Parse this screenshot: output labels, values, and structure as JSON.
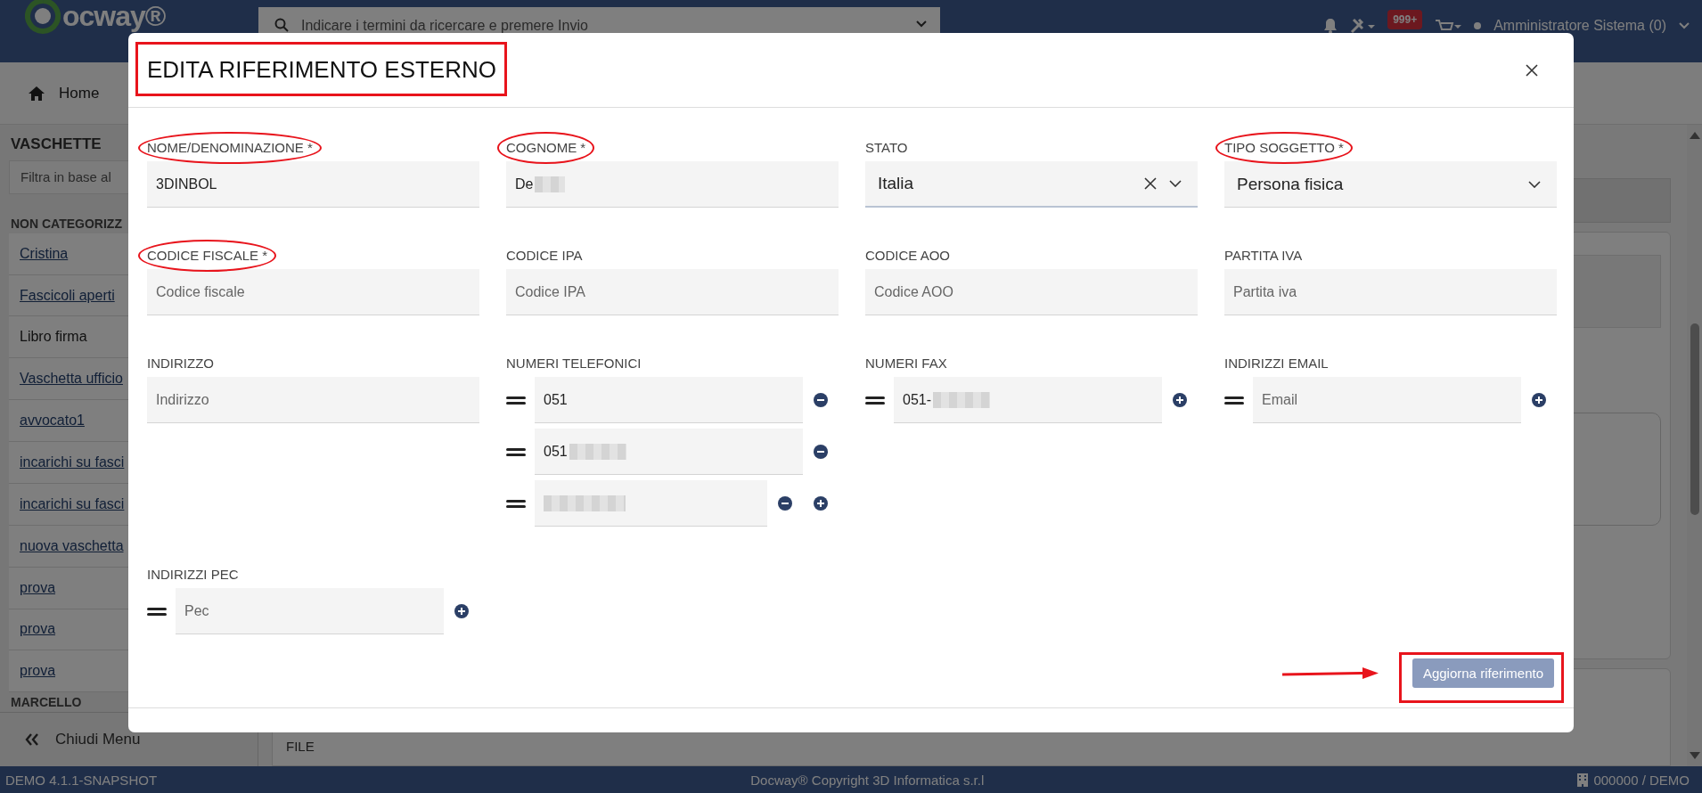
{
  "header": {
    "logo_text": "ocway®",
    "search_placeholder": "Indicare i termini da ricercare e premere Invio",
    "notification_badge": "999+",
    "user_name": "Amministratore Sistema (0)"
  },
  "breadcrumb": {
    "label": "Home"
  },
  "sidebar": {
    "title": "VASCHETTE",
    "filter_placeholder": "Filtra in base al",
    "groups": [
      {
        "title": "NON CATEGORIZZ",
        "items": [
          {
            "label": "Cristina",
            "link": true
          },
          {
            "label": "Fascicoli aperti",
            "link": true
          },
          {
            "label": "Libro firma",
            "link": false
          },
          {
            "label": "Vaschetta ufficio",
            "link": true
          },
          {
            "label": "avvocato1",
            "link": true
          },
          {
            "label": "incarichi su fasci",
            "link": true
          },
          {
            "label": "incarichi su fasci",
            "link": true
          },
          {
            "label": "nuova vaschetta",
            "link": true
          },
          {
            "label": "prova",
            "link": true
          },
          {
            "label": "prova",
            "link": true
          },
          {
            "label": "prova",
            "link": true
          }
        ]
      },
      {
        "title": "MARCELLO"
      }
    ],
    "close_menu": "Chiudi Menu"
  },
  "main": {
    "section_label": "FILE"
  },
  "modal": {
    "title": "EDITA RIFERIMENTO ESTERNO",
    "title_highlighted": true,
    "fields": [
      {
        "kind": "text",
        "label": "NOME/DENOMINAZIONE *",
        "highlighted": true,
        "value": "3DINBOL",
        "redacted": false
      },
      {
        "kind": "text",
        "label": "COGNOME *",
        "highlighted": true,
        "value": "De",
        "redacted": true
      },
      {
        "kind": "select",
        "label": "STATO",
        "highlighted": false,
        "value": "Italia",
        "clearable": true
      },
      {
        "kind": "select",
        "label": "TIPO SOGGETTO *",
        "highlighted": true,
        "value": "Persona fisica",
        "clearable": false
      },
      {
        "kind": "text",
        "label": "CODICE FISCALE *",
        "highlighted": true,
        "placeholder": "Codice fiscale"
      },
      {
        "kind": "text",
        "label": "CODICE IPA",
        "highlighted": false,
        "placeholder": "Codice IPA"
      },
      {
        "kind": "text",
        "label": "CODICE AOO",
        "highlighted": false,
        "placeholder": "Codice AOO"
      },
      {
        "kind": "text",
        "label": "PARTITA IVA",
        "highlighted": false,
        "placeholder": "Partita iva"
      },
      {
        "kind": "text",
        "label": "INDIRIZZO",
        "highlighted": false,
        "placeholder": "Indirizzo"
      },
      {
        "kind": "multi",
        "label": "NUMERI TELEFONICI",
        "highlighted": false,
        "entries": [
          {
            "value": "051",
            "redacted": false,
            "removable": true,
            "addable": false
          },
          {
            "value": "051",
            "redacted": true,
            "removable": true,
            "addable": false
          },
          {
            "redacted": true,
            "removable": true,
            "addable": true
          }
        ]
      },
      {
        "kind": "multi",
        "label": "NUMERI FAX",
        "highlighted": false,
        "entries": [
          {
            "value": "051-",
            "redacted": true,
            "removable": false,
            "addable": true
          }
        ]
      },
      {
        "kind": "multi",
        "label": "INDIRIZZI EMAIL",
        "highlighted": false,
        "entries": [
          {
            "placeholder": "Email",
            "redacted": false,
            "removable": false,
            "addable": true
          }
        ]
      },
      {
        "kind": "multi",
        "label": "INDIRIZZI PEC",
        "highlighted": false,
        "entries": [
          {
            "placeholder": "Pec",
            "redacted": false,
            "removable": false,
            "addable": true
          }
        ]
      }
    ],
    "submit": {
      "label": "Aggiorna riferimento",
      "disabled": true,
      "highlighted": true,
      "arrow": true
    }
  },
  "status_bar": {
    "version": "DEMO 4.1.1-SNAPSHOT",
    "copyright": "Docway® Copyright 3D Informatica s.r.l",
    "account": "000000 / DEMO"
  }
}
